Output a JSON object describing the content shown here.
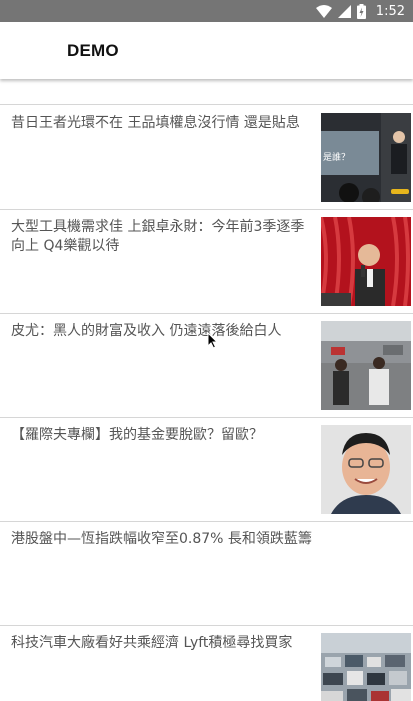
{
  "status_bar": {
    "time": "1:52"
  },
  "app_bar": {
    "title": "DEMO"
  },
  "articles": [
    {
      "title": ""
    },
    {
      "title": "昔日王者光環不在 王品填權息沒行情 還是貼息",
      "thumb_text": "是誰？"
    },
    {
      "title": "大型工具機需求佳 上銀卓永財：今年前3季逐季向上 Q4樂觀以待"
    },
    {
      "title": "皮尤：黑人的財富及收入 仍遠遠落後給白人"
    },
    {
      "title": "【羅際夫專欄】我的基金要脫歐？留歐？"
    },
    {
      "title": "港股盤中—恆指跌幅收窄至0.87% 長和領跌藍籌"
    },
    {
      "title": "科技汽車大廠看好共乘經濟 Lyft積極尋找買家"
    }
  ],
  "colors": {
    "status_bar": "#757575",
    "title_text": "#555555",
    "divider": "#d6d6d6"
  }
}
